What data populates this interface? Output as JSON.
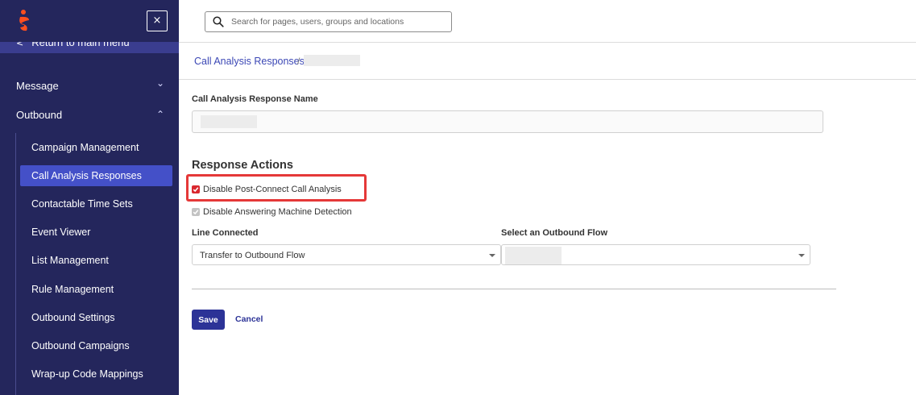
{
  "sidebar": {
    "close_label": "×",
    "return_label": "Return to main menu",
    "sections": [
      {
        "label": "Message",
        "expanded": false
      },
      {
        "label": "Outbound",
        "expanded": true
      }
    ],
    "items": [
      {
        "label": "Campaign Management",
        "active": false
      },
      {
        "label": "Call Analysis Responses",
        "active": true
      },
      {
        "label": "Contactable Time Sets",
        "active": false
      },
      {
        "label": "Event Viewer",
        "active": false
      },
      {
        "label": "List Management",
        "active": false
      },
      {
        "label": "Rule Management",
        "active": false
      },
      {
        "label": "Outbound Settings",
        "active": false
      },
      {
        "label": "Outbound Campaigns",
        "active": false
      },
      {
        "label": "Wrap-up Code Mappings",
        "active": false
      }
    ]
  },
  "header": {
    "search_placeholder": "Search for pages, users, groups and locations"
  },
  "breadcrumb": {
    "parent": "Call Analysis Responses",
    "separator": "/"
  },
  "form": {
    "name_label": "Call Analysis Response Name",
    "actions_heading": "Response Actions",
    "checkbox_post_connect": {
      "label": "Disable Post-Connect Call Analysis",
      "checked": true
    },
    "checkbox_amd": {
      "label": "Disable Answering Machine Detection",
      "checked": true,
      "disabled": true
    },
    "line_connected_label": "Line Connected",
    "line_connected_value": "Transfer to Outbound Flow",
    "outbound_flow_label": "Select an Outbound Flow",
    "save_label": "Save",
    "cancel_label": "Cancel"
  },
  "colors": {
    "sidebar_bg": "#24265c",
    "active_item": "#4450c8",
    "accent": "#2c3397",
    "highlight": "#e53838",
    "checkbox_checked": "#d9282f"
  }
}
